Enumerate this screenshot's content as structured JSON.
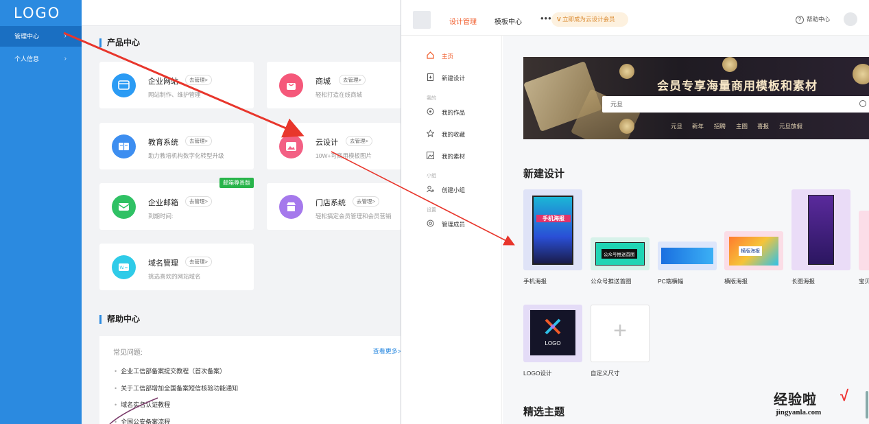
{
  "admin": {
    "logo": "LOGO",
    "sidebar": [
      {
        "label": "管理中心",
        "arrow": "›"
      },
      {
        "label": "个人信息",
        "arrow": "›"
      }
    ],
    "product_section_title": "产品中心",
    "manage_label": "去管理>",
    "products": [
      {
        "name": "企业网站",
        "desc": "网站制作、维护管理",
        "color": "#2b9bf4"
      },
      {
        "name": "商城",
        "desc": "轻松打造在线商城",
        "color": "#f5587a"
      },
      {
        "name": "教育系统",
        "desc": "助力教培机构数字化转型升级",
        "color": "#3d8ef0"
      },
      {
        "name": "云设计",
        "desc": "10W+可商用模板图片",
        "color": "#f36084"
      },
      {
        "name": "企业邮箱",
        "desc": "到期时间:",
        "color": "#2fc164",
        "badge": "邮箱尊贵版"
      },
      {
        "name": "门店系统",
        "desc": "轻松搞定会员管理和会员营销",
        "color": "#a579ec"
      },
      {
        "name": "域名管理",
        "desc": "挑选喜欢的网站域名",
        "color": "#2fcbe8"
      }
    ],
    "help_section_title": "帮助中心",
    "help_question_label": "常见问题:",
    "help_more": "查看更多>",
    "help_links": [
      "企业工信部备案提交教程（首次备案）",
      "关于工信部增加全国备案短信核验功能通知",
      "域名实名认证教程",
      "全国公安备案流程"
    ]
  },
  "design": {
    "nav_tabs": [
      "设计管理",
      "模板中心"
    ],
    "more": "•••",
    "vip_button": "立即成为云设计会员",
    "help_center": "帮助中心",
    "sidebar": {
      "items": [
        {
          "label": "主页",
          "icon": "home-icon"
        },
        {
          "label": "新建设计",
          "icon": "new-file-icon"
        }
      ],
      "group_mine": "我的",
      "mine_items": [
        {
          "label": "我的作品",
          "icon": "works-icon"
        },
        {
          "label": "我的收藏",
          "icon": "star-icon"
        },
        {
          "label": "我的素材",
          "icon": "image-icon"
        }
      ],
      "group_team": "小组",
      "team_items": [
        {
          "label": "创建小组",
          "icon": "team-icon"
        }
      ],
      "group_settings": "设置",
      "settings_items": [
        {
          "label": "管理成员",
          "icon": "gear-icon"
        }
      ]
    },
    "banner": {
      "title": "会员专享海量商用模板和素材",
      "search_value": "元旦",
      "tags": [
        "元旦",
        "新年",
        "招聘",
        "主图",
        "喜报",
        "元旦放假"
      ]
    },
    "new_design_title": "新建设计",
    "templates": [
      {
        "label": "手机海报",
        "text": "手机海报"
      },
      {
        "label": "公众号推送首图",
        "text": "公众号推送首图"
      },
      {
        "label": "PC端横幅",
        "text": ""
      },
      {
        "label": "横版海报",
        "text": "横版海报"
      },
      {
        "label": "长图海报",
        "text": ""
      },
      {
        "label": "宝贝",
        "text": ""
      },
      {
        "label": "LOGO设计",
        "text": "LOGO"
      },
      {
        "label": "自定义尺寸",
        "text": "+"
      }
    ],
    "selected_topics_title": "精选主题"
  },
  "watermark": {
    "text": "经验啦",
    "check": "√",
    "url": "jingyanla.com"
  }
}
